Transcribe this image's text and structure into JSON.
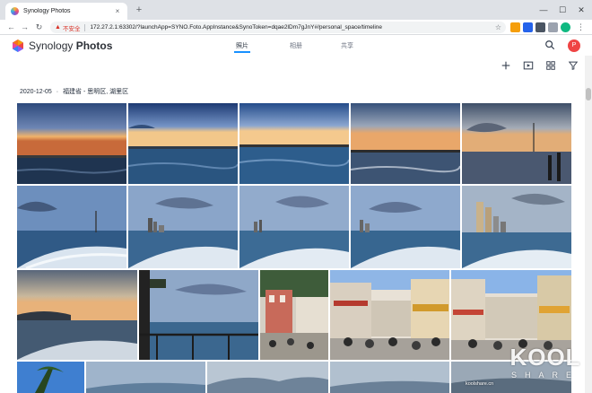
{
  "browser": {
    "tab_title": "Synology Photos",
    "tab_close": "×",
    "new_tab": "+",
    "window_controls": [
      "—",
      "☐",
      "✕"
    ],
    "security_label": "不安全",
    "url": "172.27.2.1:63302/?launchApp=SYNO.Foto.AppInstance&SynoToken=dqae2lDm7gJnY#/personal_space/timeline"
  },
  "app": {
    "brand_regular": "Synology ",
    "brand_bold": "Photos",
    "tabs": [
      {
        "label": "照片",
        "active": true
      },
      {
        "label": "相册",
        "active": false
      },
      {
        "label": "共享",
        "active": false
      }
    ],
    "avatar_initial": "P"
  },
  "timeline": {
    "date": "2020-12-05",
    "location": "福建省 - 思明区, 湖里区",
    "separator": "·"
  },
  "watermark": {
    "big": "KOOL",
    "small": "SHARE",
    "url": "koolshare.cn"
  },
  "colors": {
    "accent": "#1890ff",
    "avatar": "#ef4444",
    "insecure": "#d93025"
  }
}
